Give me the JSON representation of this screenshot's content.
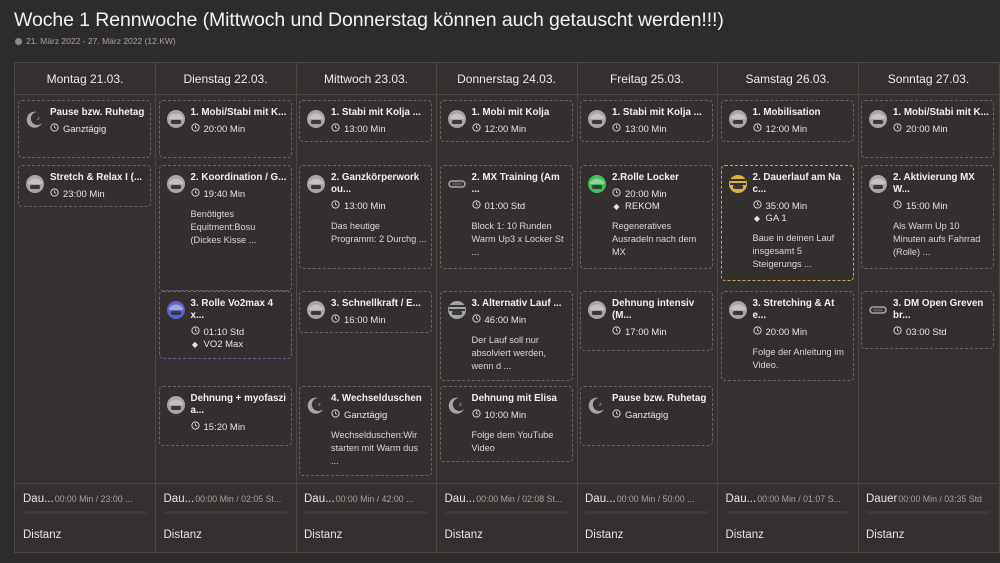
{
  "header": {
    "title": "Woche 1 Rennwoche (Mittwoch und Donnerstag können auch getauscht werden!!!)",
    "date_range": "21. März 2022 - 27. März 2022 (12.KW)"
  },
  "colors": {
    "card_border": "#6a6664",
    "blue_border": "#5f63b0",
    "yellow_border": "#c9a94a",
    "avatar_gray": "#a8a6a4",
    "avatar_green": "#3fbf5a",
    "avatar_blue": "#5a63d6",
    "avatar_yellow": "#d9b23c"
  },
  "days": [
    {
      "label": "Montag 21.03.",
      "cards": [
        {
          "icon": "moon",
          "title": "Pause bzw. Ruhetag",
          "meta": "Ganztägig",
          "top": 0
        },
        {
          "icon": "face-gray",
          "title": "Stretch & Relax I (...",
          "meta": "23:00 Min",
          "top": 1
        }
      ],
      "footer": {
        "label": "Dau...",
        "value": "00:00 Min / 23:00 ...",
        "dist": "Distanz"
      }
    },
    {
      "label": "Dienstag 22.03.",
      "cards": [
        {
          "icon": "face-gray",
          "title": "1. Mobi/Stabi mit K...",
          "meta": "20:00 Min"
        },
        {
          "icon": "face-gray",
          "title": "2. Koordination / G...",
          "meta": "19:40 Min",
          "desc": "Benötigtes Equitment:Bosu (Dickes Kisse ..."
        },
        {
          "icon": "face-blue",
          "title": "3. Rolle Vo2max 4 x...",
          "meta": "01:10 Std",
          "meta2": "VO2 Max",
          "style": "blue"
        },
        {
          "icon": "face-gray",
          "title": "Dehnung + myofaszia...",
          "meta": "15:20 Min"
        }
      ],
      "footer": {
        "label": "Dau...",
        "value": "00:00 Min / 02:05 St...",
        "dist": "Distanz"
      }
    },
    {
      "label": "Mittwoch 23.03.",
      "cards": [
        {
          "icon": "face-gray",
          "title": "1. Stabi mit Kolja ...",
          "meta": "13:00 Min"
        },
        {
          "icon": "face-gray",
          "title": "2. Ganzkörperwork ou...",
          "meta": "13:00 Min",
          "desc": "Das heutige Programm: 2 Durchg ..."
        },
        {
          "icon": "face-gray",
          "title": "3. Schnellkraft / E...",
          "meta": "16:00 Min"
        },
        {
          "icon": "moon",
          "title": "4. Wechselduschen",
          "meta": "Ganztägig",
          "desc": "Wechselduschen:Wir starten mit Warm dus ..."
        }
      ],
      "footer": {
        "label": "Dau...",
        "value": "00:00 Min / 42:00 ...",
        "dist": "Distanz"
      }
    },
    {
      "label": "Donnerstag 24.03.",
      "cards": [
        {
          "icon": "face-gray",
          "title": "1. Mobi mit Kolja",
          "meta": "12:00 Min"
        },
        {
          "icon": "goggles",
          "title": "2. MX Training (Am ...",
          "meta": "01:00 Std",
          "desc": "Block 1: 10 Runden Warm Up3 x Locker St ..."
        },
        {
          "icon": "face-striped",
          "title": "3. Alternativ Lauf ...",
          "meta": "46:00 Min",
          "desc": "Der Lauf soll nur absolviert werden, wenn d ..."
        },
        {
          "icon": "moon",
          "title": "Dehnung mit Elisa",
          "meta": "10:00 Min",
          "desc": "Folge dem YouTube Video"
        }
      ],
      "footer": {
        "label": "Dau...",
        "value": "00:00 Min / 02:08 St...",
        "dist": "Distanz"
      }
    },
    {
      "label": "Freitag 25.03.",
      "cards": [
        {
          "icon": "face-gray",
          "title": "1. Stabi mit Kolja ...",
          "meta": "13:00 Min"
        },
        {
          "icon": "face-green",
          "title": "2.Rolle Locker",
          "meta": "20:00 Min",
          "meta2": "REKOM",
          "desc": "Regeneratives Ausradeln nach dem MX"
        },
        {
          "icon": "face-gray",
          "title": "Dehnung intensiv (M...",
          "meta": "17:00 Min"
        },
        {
          "icon": "moon",
          "title": "Pause bzw. Ruhetag",
          "meta": "Ganztägig"
        }
      ],
      "footer": {
        "label": "Dau...",
        "value": "00:00 Min / 50:00 ...",
        "dist": "Distanz"
      }
    },
    {
      "label": "Samstag 26.03.",
      "cards": [
        {
          "icon": "face-gray",
          "title": "1. Mobilisation",
          "meta": "12:00 Min"
        },
        {
          "icon": "face-yellow",
          "title": "2. Dauerlauf am Na c...",
          "meta": "35:00 Min",
          "meta2": "GA 1",
          "desc": "Baue in deinen Lauf insgesamt 5 Steigerungs ...",
          "style": "yellow"
        },
        {
          "icon": "face-gray",
          "title": "3. Stretching & At e...",
          "meta": "20:00 Min",
          "desc": "Folge der Anleitung im Video."
        }
      ],
      "footer": {
        "label": "Dau...",
        "value": "00:00 Min / 01:07 S...",
        "dist": "Distanz"
      }
    },
    {
      "label": "Sonntag 27.03.",
      "cards": [
        {
          "icon": "face-gray",
          "title": "1. Mobi/Stabi mit K...",
          "meta": "20:00 Min"
        },
        {
          "icon": "face-gray",
          "title": "2. Aktivierung MX W...",
          "meta": "15:00 Min",
          "desc": "Als Warm Up 10 Minuten aufs Fahrrad (Rolle) ..."
        },
        {
          "icon": "goggles",
          "title": "3. DM Open Greven br...",
          "meta": "03:00 Std"
        }
      ],
      "footer": {
        "label": "Dauer",
        "value": "00:00 Min / 03:35 Std",
        "dist": "Distanz"
      }
    }
  ]
}
